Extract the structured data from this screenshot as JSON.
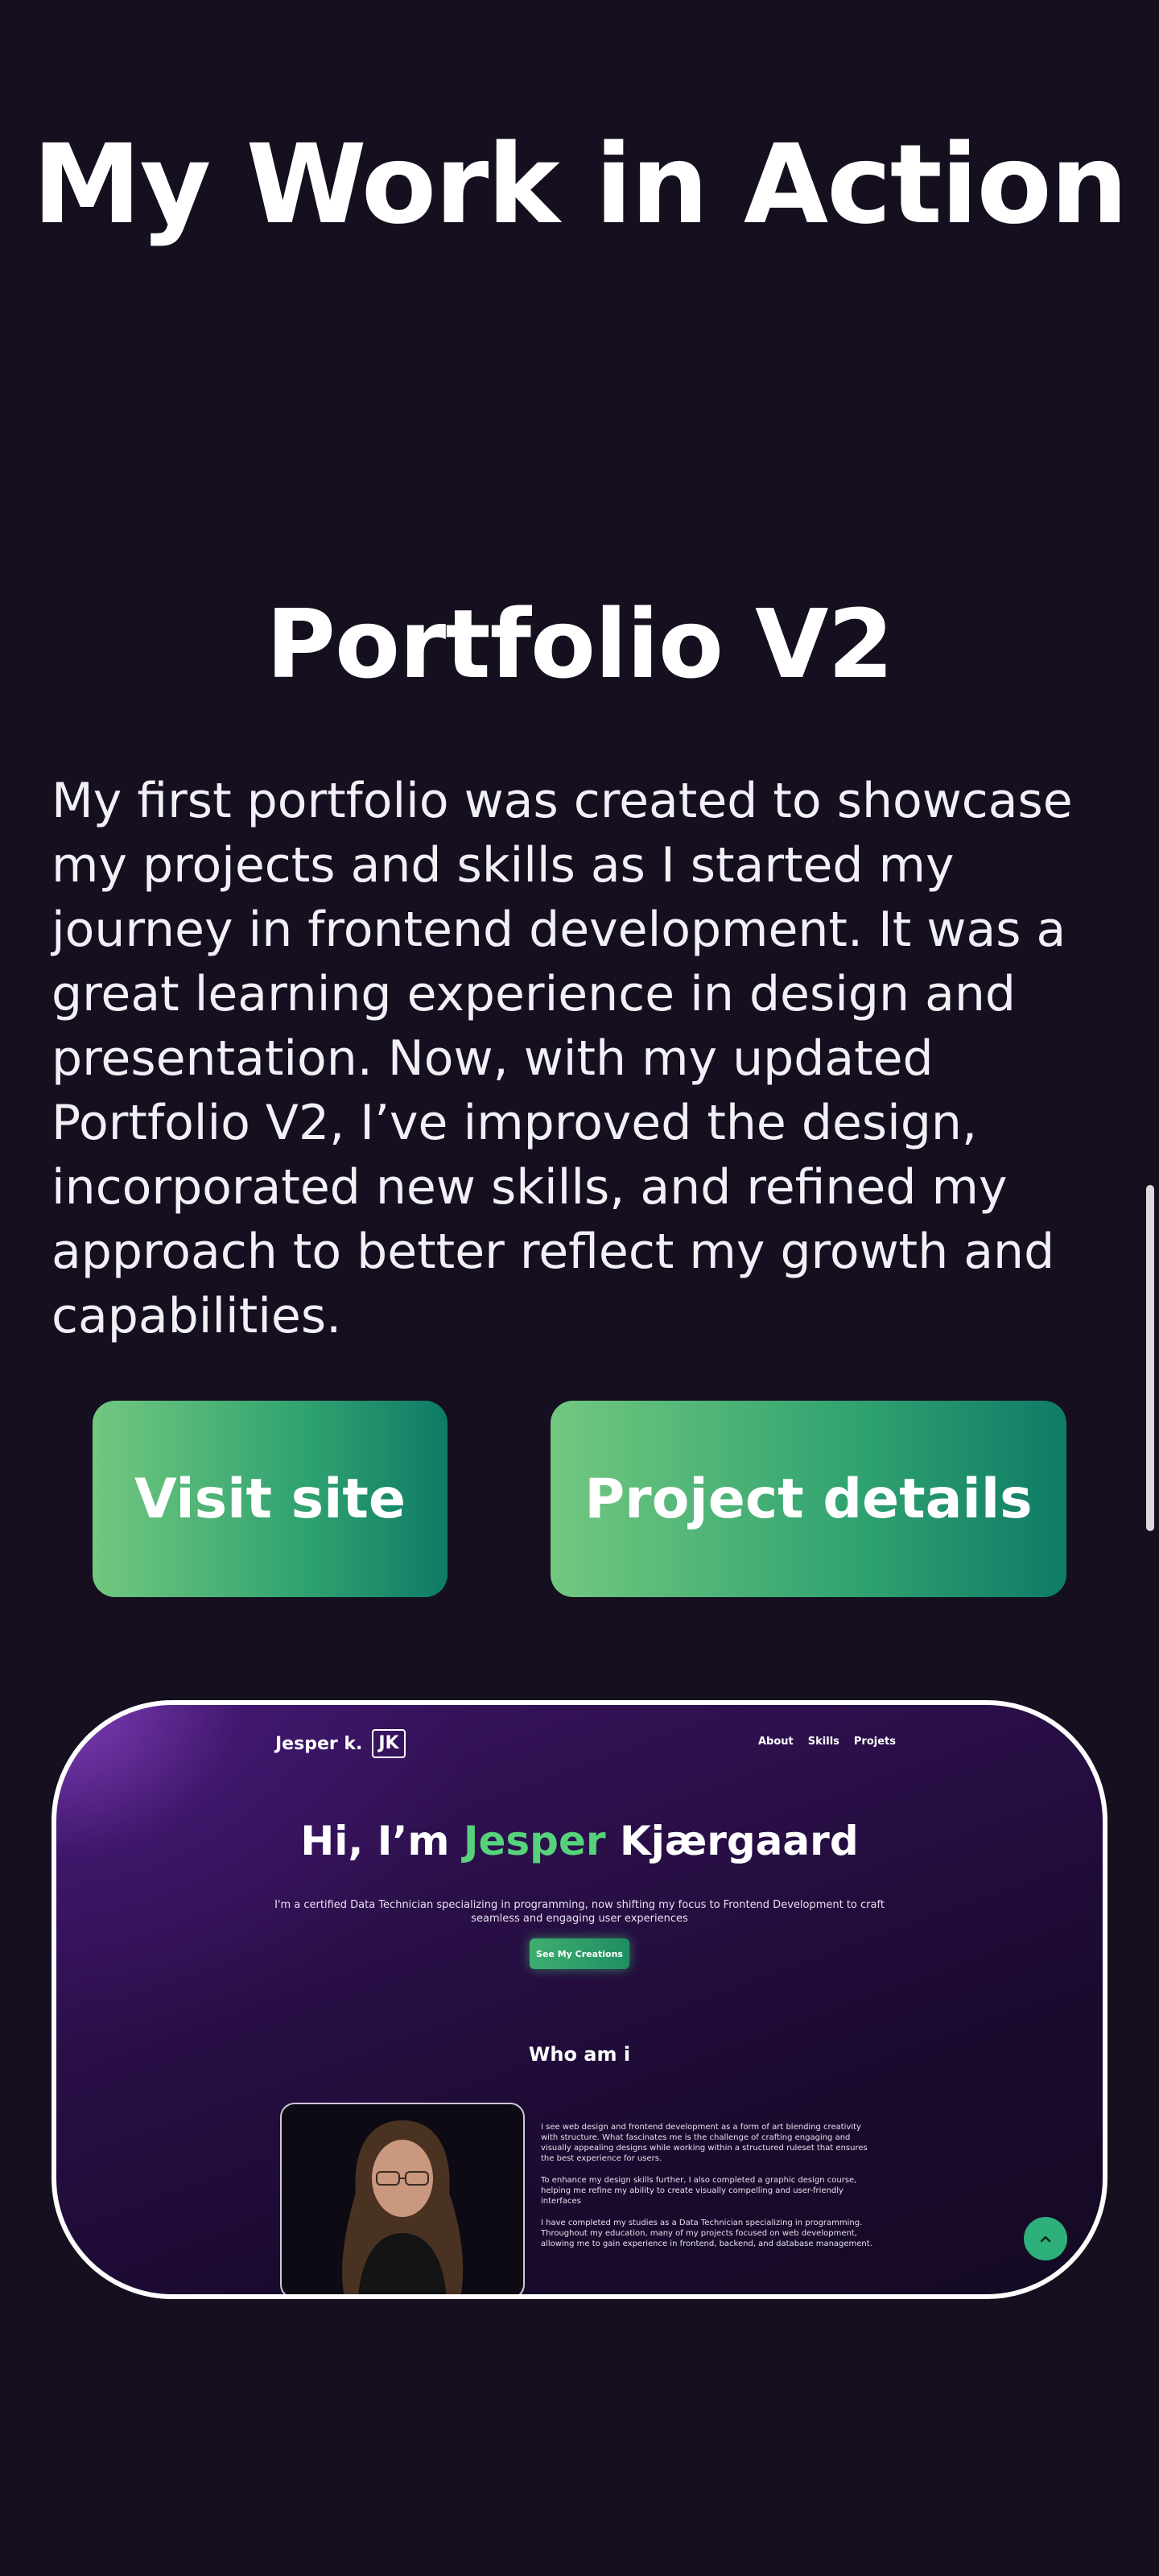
{
  "section": {
    "title": "My Work in Action"
  },
  "project": {
    "title": "Portfolio V2",
    "description": "My first portfolio was created to showcase my projects and skills as I started my journey in frontend development. It was a great learning experience in design and presentation. Now, with my updated Portfolio V2, I’ve improved the design, incorporated new skills, and refined my approach to better reflect my growth and capabilities.",
    "buttons": {
      "visit": "Visit site",
      "details": "Project details"
    }
  },
  "preview": {
    "brand_name": "Jesper k.",
    "brand_logo": "JK",
    "nav": [
      "About",
      "Skills",
      "Projets"
    ],
    "hero": {
      "prefix": "Hi, I’m",
      "highlight": "Jesper",
      "suffix": "Kjærgaard"
    },
    "subtitle": "I'm a certified Data Technician specializing in programming, now shifting my focus to Frontend Development to craft seamless and engaging user experiences",
    "cta": "See My Creations",
    "about_heading": "Who am i",
    "about_paragraphs": [
      "I see web design and frontend development as a form of art blending creativity with structure. What fascinates me is the challenge of crafting engaging and visually appealing designs while working within a structured ruleset that ensures the best experience for users.",
      "To enhance my design skills further, I also completed a graphic design course, helping me refine my ability to create visually compelling and user-friendly interfaces",
      "I have completed my studies as a Data Technician specializing in programming. Throughout my education, many of my projects focused on web development, allowing me to gain experience in frontend, backend, and database management."
    ],
    "scroll_top_icon": "chevron-up-icon"
  },
  "colors": {
    "background": "#150f20",
    "accent_green": "#56d27a",
    "button_gradient_start": "#72c87f",
    "button_gradient_end": "#0e7b66"
  }
}
